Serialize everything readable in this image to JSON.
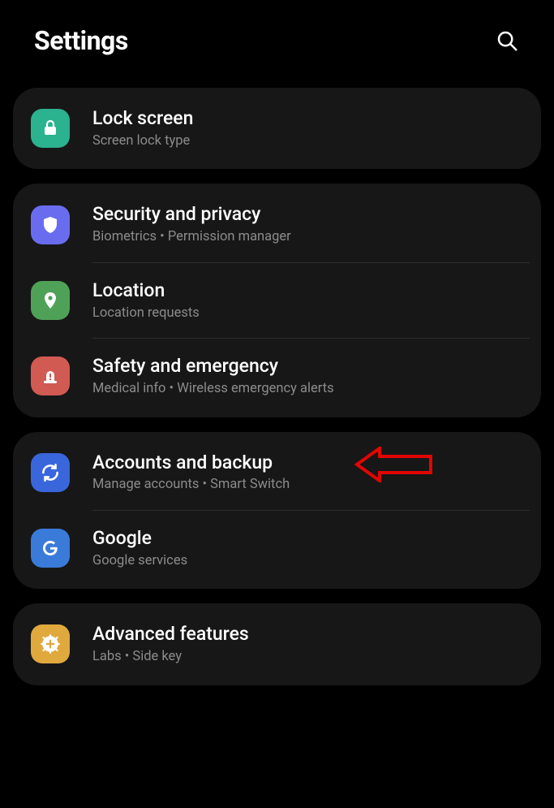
{
  "header": {
    "title": "Settings"
  },
  "groups": [
    {
      "items": [
        {
          "key": "lock",
          "title": "Lock screen",
          "sub": "Screen lock type",
          "icon": "lock-icon",
          "color": "#2bb28e"
        }
      ]
    },
    {
      "items": [
        {
          "key": "security",
          "title": "Security and privacy",
          "sub": "Biometrics  •  Permission manager",
          "icon": "shield-icon",
          "color": "#6a6cf0"
        },
        {
          "key": "location",
          "title": "Location",
          "sub": "Location requests",
          "icon": "pin-icon",
          "color": "#4fa158"
        },
        {
          "key": "safety",
          "title": "Safety and emergency",
          "sub": "Medical info  •  Wireless emergency alerts",
          "icon": "siren-icon",
          "color": "#d15a52"
        }
      ]
    },
    {
      "items": [
        {
          "key": "accounts",
          "title": "Accounts and backup",
          "sub": "Manage accounts  •  Smart Switch",
          "icon": "sync-icon",
          "color": "#3a66db",
          "annotated": true
        },
        {
          "key": "google",
          "title": "Google",
          "sub": "Google services",
          "icon": "google-icon",
          "color": "#3a7ad9"
        }
      ]
    },
    {
      "items": [
        {
          "key": "advanced",
          "title": "Advanced features",
          "sub": "Labs  •  Side key",
          "icon": "plus-gear-icon",
          "color": "#e0a93e"
        }
      ]
    }
  ],
  "annotation": {
    "arrow_color": "#e10600"
  }
}
